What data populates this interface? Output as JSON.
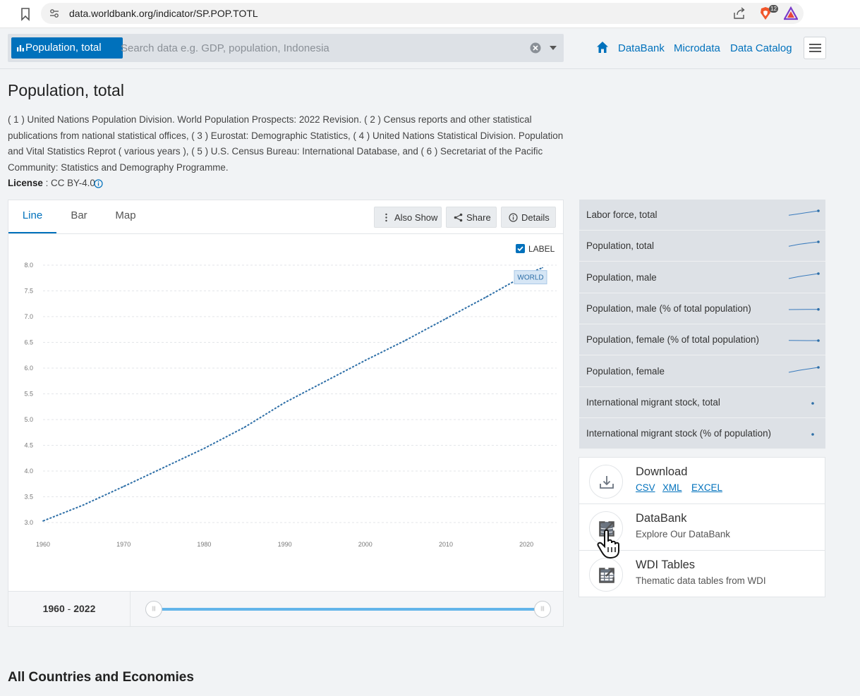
{
  "browser": {
    "url": "data.worldbank.org/indicator/SP.POP.TOTL",
    "brave_count": "12"
  },
  "header": {
    "indicator_chip": "Population, total",
    "search_placeholder": "Search data e.g. GDP, population, Indonesia",
    "nav": [
      "DataBank",
      "Microdata",
      "Data Catalog"
    ]
  },
  "title": "Population, total",
  "source": "( 1 ) United Nations Population Division. World Population Prospects: 2022 Revision. ( 2 ) Census reports and other statistical publications from national statistical offices, ( 3 ) Eurostat: Demographic Statistics, ( 4 ) United Nations Statistical Division. Population and Vital Statistics Reprot ( various years ), ( 5 ) U.S. Census Bureau: International Database, and ( 6 ) Secretariat of the Pacific Community: Statistics and Demography Programme.",
  "license": {
    "label": "License",
    "sep": " : ",
    "value": "CC BY-4.0"
  },
  "tabs": [
    "Line",
    "Bar",
    "Map"
  ],
  "active_tab": "Line",
  "toolbar": {
    "also_show": "Also Show",
    "share": "Share",
    "details": "Details"
  },
  "label_toggle": {
    "text": "LABEL",
    "checked": true
  },
  "range": {
    "start": "1960",
    "sep": " - ",
    "end": "2022"
  },
  "chart_data": {
    "type": "line",
    "xlabel": "",
    "ylabel": "",
    "xlim": [
      1960,
      2022
    ],
    "ylim": [
      3.0,
      8.0
    ],
    "x_ticks": [
      "1960",
      "1970",
      "1980",
      "1990",
      "2000",
      "2010",
      "2020"
    ],
    "y_ticks": [
      "3.0",
      "3.5",
      "4.0",
      "4.5",
      "5.0",
      "5.5",
      "6.0",
      "6.5",
      "7.0",
      "7.5",
      "8.0"
    ],
    "grid": true,
    "series": [
      {
        "name": "WORLD",
        "color": "#2e6fa7",
        "x": [
          1960,
          1965,
          1970,
          1975,
          1980,
          1985,
          1990,
          1995,
          2000,
          2005,
          2010,
          2015,
          2020,
          2022
        ],
        "y": [
          3.03,
          3.34,
          3.7,
          4.07,
          4.44,
          4.85,
          5.33,
          5.74,
          6.15,
          6.54,
          6.96,
          7.38,
          7.82,
          7.95
        ]
      }
    ]
  },
  "related": [
    {
      "label": "Labor force, total",
      "spark": [
        0.55,
        0.7,
        0.85,
        1.0
      ]
    },
    {
      "label": "Population, total",
      "spark": [
        0.55,
        0.75,
        0.88,
        1.0
      ]
    },
    {
      "label": "Population, male",
      "spark": [
        0.5,
        0.7,
        0.85,
        1.0
      ]
    },
    {
      "label": "Population, male (% of total population)",
      "spark": [
        0.5,
        0.51,
        0.52,
        0.52
      ]
    },
    {
      "label": "Population, female (% of total population)",
      "spark": [
        0.52,
        0.51,
        0.5,
        0.5
      ]
    },
    {
      "label": "Population, female",
      "spark": [
        0.5,
        0.7,
        0.85,
        1.0
      ]
    },
    {
      "label": "International migrant stock, total",
      "spark": [
        0.5
      ]
    },
    {
      "label": "International migrant stock (% of population)",
      "spark": [
        0.5
      ]
    }
  ],
  "download": {
    "title": "Download",
    "links": [
      "CSV",
      "XML",
      "EXCEL"
    ]
  },
  "databank": {
    "title": "DataBank",
    "sub": "Explore Our DataBank"
  },
  "wdi": {
    "title": "WDI Tables",
    "sub": "Thematic data tables from WDI"
  },
  "section_title": "All Countries and Economies",
  "colors": {
    "accent": "#0071bc",
    "line": "#2e6fa7",
    "slider": "#63b5ea"
  }
}
